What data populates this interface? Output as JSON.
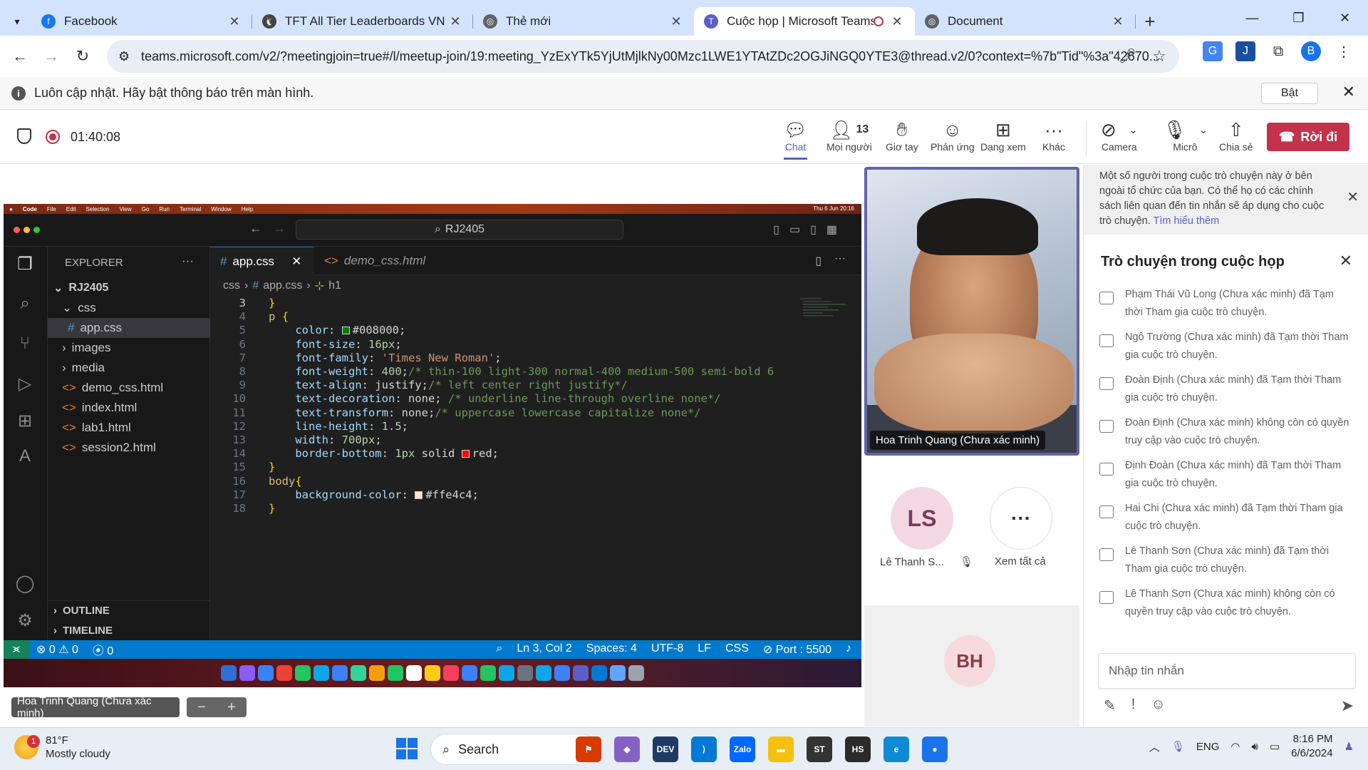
{
  "browser": {
    "tabs": [
      {
        "title": "Facebook",
        "fav_color": "#1877f2",
        "fav_glyph": "f"
      },
      {
        "title": "TFT All Tier Leaderboards VN -",
        "fav_color": "#444444",
        "fav_glyph": "🐧"
      },
      {
        "title": "Thẻ mới",
        "fav_color": "#5f6368",
        "fav_glyph": "◎"
      },
      {
        "title": "Cuộc họp | Microsoft Teams",
        "fav_color": "#5b5fc7",
        "fav_glyph": "T"
      },
      {
        "title": "Document",
        "fav_color": "#5f6368",
        "fav_glyph": "◎"
      }
    ],
    "url": "teams.microsoft.com/v2/?meetingjoin=true#/l/meetup-join/19:meeting_YzExYTk5YjUtMjlkNy00Mzc1LWE1YTAtZDc2OGJiNGQ0YTE3@thread.v2/0?context=%7b\"Tid\"%3a\"42670...",
    "profile_initial": "B"
  },
  "infobar": {
    "text": "Luôn cập nhật. Hãy bật thông báo trên màn hình.",
    "button": "Bật"
  },
  "meeting": {
    "timer": "01:40:08",
    "toolbar": {
      "chat": "Chat",
      "people": "Mọi người",
      "people_count": "13",
      "raise": "Giơ tay",
      "react": "Phản ứng",
      "view": "Dạng xem",
      "more": "Khác",
      "camera": "Camera",
      "mic": "Micrô",
      "share": "Chia sẻ",
      "leave": "Rời đi"
    }
  },
  "screenshare": {
    "menubar": [
      "Code",
      "File",
      "Edit",
      "Selection",
      "View",
      "Go",
      "Run",
      "Terminal",
      "Window",
      "Help"
    ],
    "menubar_time": "Thu 6 Jun 20:16",
    "search": "RJ2405",
    "explorer_title": "EXPLORER",
    "root": "RJ2405",
    "files": [
      "css",
      "app.css",
      "images",
      "media",
      "demo_css.html",
      "index.html",
      "lab1.html",
      "session2.html"
    ],
    "outline": "OUTLINE",
    "timeline": "TIMELINE",
    "tab_active": "app.css",
    "tab_other": "demo_css.html",
    "crumb": [
      "css",
      "app.css",
      "h1"
    ],
    "lines": [
      {
        "n": "3",
        "html": "<span class='b'>}</span>"
      },
      {
        "n": "4",
        "html": "<span class='s'>p</span> <span class='b'>{</span>"
      },
      {
        "n": "5",
        "html": "    <span class='k'>color</span>: <span class='sw' style='background:#008000'></span>#008000;"
      },
      {
        "n": "6",
        "html": "    <span class='k'>font-size</span>: <span class='n'>16px</span>;"
      },
      {
        "n": "7",
        "html": "    <span class='k'>font-family</span>: <span class='v'>'Times New Roman'</span>;"
      },
      {
        "n": "8",
        "html": "    <span class='k'>font-weight</span>: <span class='n'>400</span>;<span class='c'>/* thin-100 light-300 normal-400 medium-500 semi-bold 6</span>"
      },
      {
        "n": "9",
        "html": "    <span class='k'>text-align</span>: justify;<span class='c'>/* left center right justify*/</span>"
      },
      {
        "n": "10",
        "html": "    <span class='k'>text-decoration</span>: none; <span class='c'>/* underline line-through overline none*/</span>"
      },
      {
        "n": "11",
        "html": "    <span class='k'>text-transform</span>: none;<span class='c'>/* uppercase lowercase capitalize none*/</span>"
      },
      {
        "n": "12",
        "html": "    <span class='k'>line-height</span>: <span class='n'>1.5</span>;"
      },
      {
        "n": "13",
        "html": "    <span class='k'>width</span>: <span class='n'>700px</span>;"
      },
      {
        "n": "14",
        "html": "    <span class='k'>border-bottom</span>: <span class='n'>1px</span> solid <span class='sw' style='background:#ff0000'></span>red;"
      },
      {
        "n": "15",
        "html": "<span class='b'>}</span>"
      },
      {
        "n": "16",
        "html": "<span class='s'>body</span><span class='b'>{</span>"
      },
      {
        "n": "17",
        "html": "    <span class='k'>background-color</span>: <span class='sw' style='background:#ffe4c4'></span>#ffe4c4;"
      },
      {
        "n": "18",
        "html": "<span class='b'>}</span>"
      }
    ],
    "status": {
      "errors": "⊗ 0 ⚠ 0",
      "ports": "0",
      "pos": "Ln 3, Col 2",
      "spaces": "Spaces: 4",
      "enc": "UTF-8",
      "eol": "LF",
      "lang": "CSS",
      "port": "Port : 5500"
    },
    "presenter": "Hoa Trinh Quang (Chưa xác minh)"
  },
  "gallery": {
    "video_name": "Hoa Trinh Quang (Chưa xác minh)",
    "ls_initials": "LS",
    "ls_name": "Lê Thanh S...",
    "see_all": "Xem tất cả",
    "bh_initials": "BH"
  },
  "chat": {
    "notice": "Một số người trong cuộc trò chuyện này ở bên ngoài tổ chức của bạn. Có thể họ có các chính sách liên quan đến tin nhắn sẽ áp dụng cho cuộc trò chuyện.",
    "notice_link": "Tìm hiểu thêm",
    "title": "Trò chuyện trong cuộc họp",
    "messages": [
      "Phạm Thái Vũ Long (Chưa xác minh) đã Tạm thời Tham gia cuộc trò chuyện.",
      "Ngô Trường (Chưa xác minh) đã Tạm thời Tham gia cuộc trò chuyện.",
      "Đoàn Định (Chưa xác minh) đã Tạm thời Tham gia cuộc trò chuyện.",
      "Đoàn Định (Chưa xác minh) không còn có quyền truy cập vào cuộc trò chuyện.",
      "Định Đoàn (Chưa xác minh) đã Tạm thời Tham gia cuộc trò chuyện.",
      "Hai Chi (Chưa xác minh) đã Tạm thời Tham gia cuộc trò chuyện.",
      "Lê Thanh Sơn (Chưa xác minh) đã Tạm thời Tham gia cuộc trò chuyện.",
      "Lê Thanh Sơn (Chưa xác minh) không còn có quyền truy cập vào cuộc trò chuyện."
    ],
    "input_placeholder": "Nhập tin nhắn"
  },
  "taskbar": {
    "temp": "81°F",
    "weather": "Mostly cloudy",
    "weather_badge": "1",
    "search": "Search",
    "lang": "ENG",
    "time": "8:16 PM",
    "date": "6/6/2024",
    "apps": [
      {
        "name": "news-app",
        "color": "#d83b01",
        "glyph": "⚑"
      },
      {
        "name": "copilot-app",
        "color": "#8661c5",
        "glyph": "◆"
      },
      {
        "name": "dev-home-app",
        "color": "#1f3a66",
        "glyph": "DEV"
      },
      {
        "name": "vscode-app",
        "color": "#0078d4",
        "glyph": "⟩"
      },
      {
        "name": "zalo-app",
        "color": "#0068ff",
        "glyph": "Zalo"
      },
      {
        "name": "file-explorer-app",
        "color": "#f4c20d",
        "glyph": "▬"
      },
      {
        "name": "sublime-app",
        "color": "#333333",
        "glyph": "ST"
      },
      {
        "name": "hs-app",
        "color": "#2b2b2b",
        "glyph": "HS"
      },
      {
        "name": "edge-app",
        "color": "#0f8bd6",
        "glyph": "e"
      },
      {
        "name": "chrome-app",
        "color": "#1a73e8",
        "glyph": "●"
      }
    ]
  },
  "colors": {
    "teams_accent": "#5b5fc7",
    "leave_red": "#c4314b",
    "vscode_status": "#007acc"
  }
}
